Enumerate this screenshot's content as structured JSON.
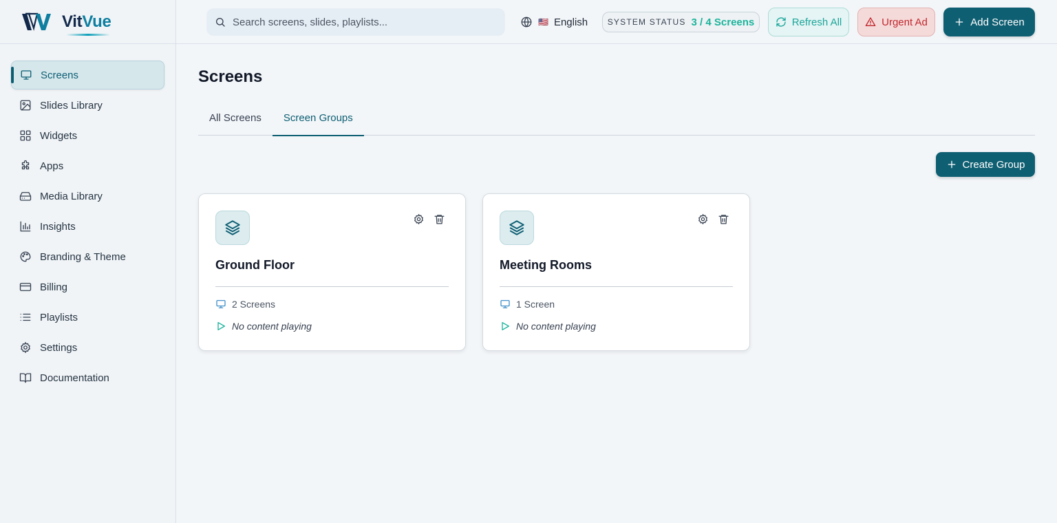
{
  "brand": {
    "name_part1": "Vit",
    "name_part2": "Vue",
    "accent": "#0e7fa0",
    "primary": "#0f5f73"
  },
  "sidebar": {
    "items": [
      {
        "label": "Screens",
        "icon": "monitor-icon",
        "active": true
      },
      {
        "label": "Slides Library",
        "icon": "image-icon"
      },
      {
        "label": "Widgets",
        "icon": "grid-icon"
      },
      {
        "label": "Apps",
        "icon": "puzzle-icon"
      },
      {
        "label": "Media Library",
        "icon": "hard-drive-icon"
      },
      {
        "label": "Insights",
        "icon": "bar-chart-icon"
      },
      {
        "label": "Branding & Theme",
        "icon": "palette-icon"
      },
      {
        "label": "Billing",
        "icon": "credit-card-icon"
      },
      {
        "label": "Playlists",
        "icon": "list-icon"
      },
      {
        "label": "Settings",
        "icon": "gear-icon"
      },
      {
        "label": "Documentation",
        "icon": "book-icon"
      }
    ]
  },
  "topbar": {
    "search_placeholder": "Search screens, slides, playlists...",
    "language": "English",
    "flag": "🇺🇸",
    "status_label": "SYSTEM STATUS",
    "status_value": "3 / 4 Screens",
    "refresh_label": "Refresh All",
    "urgent_label": "Urgent Ad",
    "add_label": "Add Screen"
  },
  "main": {
    "title": "Screens",
    "tabs": [
      {
        "label": "All Screens",
        "active": false
      },
      {
        "label": "Screen Groups",
        "active": true
      }
    ],
    "create_label": "Create Group",
    "groups": [
      {
        "name": "Ground Floor",
        "screens": "2 Screens",
        "content": "No content playing"
      },
      {
        "name": "Meeting Rooms",
        "screens": "1 Screen",
        "content": "No content playing"
      }
    ]
  }
}
